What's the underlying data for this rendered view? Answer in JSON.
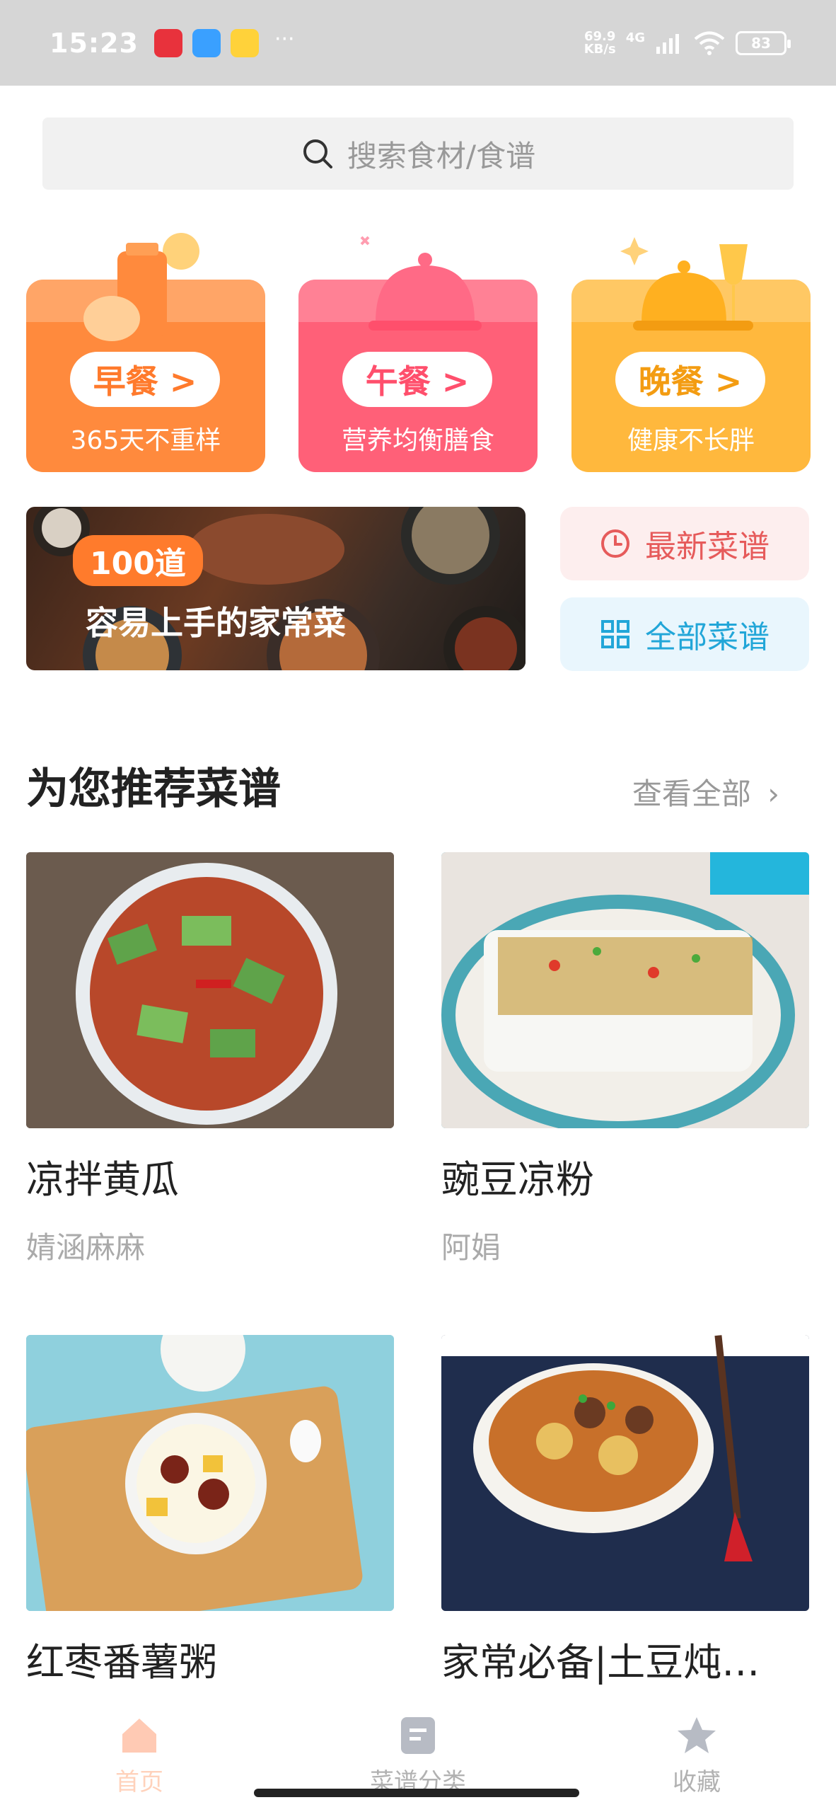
{
  "status": {
    "time": "15:23",
    "speed_value": "69.9",
    "speed_unit": "KB/s",
    "network": "4G",
    "battery": "83"
  },
  "search": {
    "placeholder": "搜索食材/食谱"
  },
  "meals": [
    {
      "label": "早餐 >",
      "sub": "365天不重样",
      "color": "#ff8a3d"
    },
    {
      "label": "午餐 >",
      "sub": "营养均衡膳食",
      "color": "#ff6078"
    },
    {
      "label": "晚餐 >",
      "sub": "健康不长胖",
      "color": "#ffb83d"
    }
  ],
  "banner": {
    "tag": "100道",
    "caption": "容易上手的家常菜"
  },
  "shortcuts": {
    "latest": "最新菜谱",
    "all": "全部菜谱"
  },
  "recommend": {
    "title": "为您推荐菜谱",
    "see_all": "查看全部"
  },
  "recipes": [
    {
      "title": "凉拌黄瓜",
      "author": "婧涵麻麻"
    },
    {
      "title": "豌豆凉粉",
      "author": "阿娟"
    },
    {
      "title": "红枣番薯粥",
      "author": ""
    },
    {
      "title": "家常必备|土豆炖…",
      "author": ""
    }
  ],
  "tabs": [
    {
      "label": "首页",
      "icon": "home-icon"
    },
    {
      "label": "菜谱分类",
      "icon": "document-icon"
    },
    {
      "label": "收藏",
      "icon": "star-icon"
    }
  ]
}
